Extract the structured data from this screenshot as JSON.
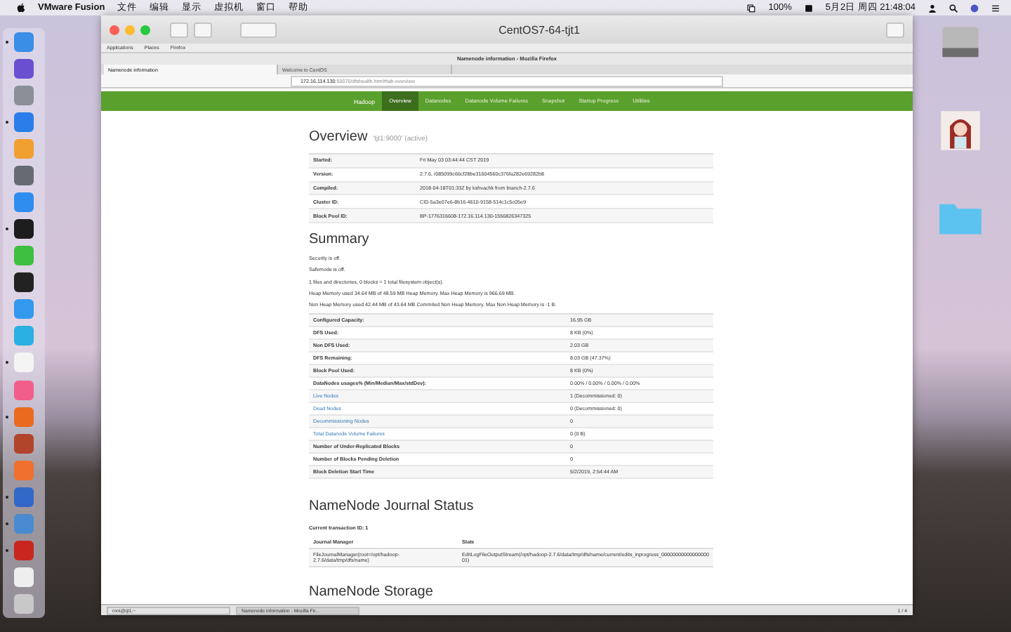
{
  "menubar": {
    "app": "VMware Fusion",
    "menus": [
      "文件",
      "编辑",
      "显示",
      "虚拟机",
      "窗口",
      "帮助"
    ],
    "battery": "100%",
    "clock": "5月2日 周四 21:48:04"
  },
  "dock": [
    {
      "running": true
    },
    {
      "running": false
    },
    {
      "running": false
    },
    {
      "running": true
    },
    {
      "running": false
    },
    {
      "running": false
    },
    {
      "running": false
    },
    {
      "running": true
    },
    {
      "running": false
    },
    {
      "running": false
    },
    {
      "running": false
    },
    {
      "running": false
    },
    {
      "running": true
    },
    {
      "running": false
    },
    {
      "running": true
    },
    {
      "running": false
    },
    {
      "running": false
    },
    {
      "running": true
    },
    {
      "running": true
    },
    {
      "running": true
    },
    {
      "running": false
    },
    {
      "running": false
    }
  ],
  "vm_window": {
    "title": "CentOS7-64-tjt1"
  },
  "gnome_top_bar": [
    "Applications",
    "Places",
    "Firefox"
  ],
  "firefox": {
    "title": "Namenode information - Mozilla Firefox",
    "tabs": [
      {
        "label": "Namenode information",
        "selected": true
      },
      {
        "label": "Welcome to CentOS",
        "selected": false
      }
    ],
    "url_host": "172.16.114.130",
    "url_path": ":50070/dfshealth.html#tab-overview"
  },
  "nav": {
    "brand": "Hadoop",
    "items": [
      {
        "label": "Overview",
        "selected": true
      },
      {
        "label": "Datanodes",
        "selected": false
      },
      {
        "label": "Datanode Volume Failures",
        "selected": false
      },
      {
        "label": "Snapshot",
        "selected": false
      },
      {
        "label": "Startup Progress",
        "selected": false
      },
      {
        "label": "Utilities",
        "selected": false
      }
    ]
  },
  "overview": {
    "title": "Overview",
    "subtitle": "'tjt1:9000' (active)",
    "rows": [
      {
        "key": "Started:",
        "value": "Fri May 03 03:44:44 CST 2019"
      },
      {
        "key": "Version:",
        "value": "2.7.6, r085099c66cf28be31604560c376fa282e69282b8"
      },
      {
        "key": "Compiled:",
        "value": "2018-04-18T01:33Z by kshvachk from branch-2.7.6"
      },
      {
        "key": "Cluster ID:",
        "value": "CID-5a3e07e6-8b16-4610-9158-514c1c5c05e9"
      },
      {
        "key": "Block Pool ID:",
        "value": "BP-1776316608-172.16.114.130-1556826347325"
      }
    ]
  },
  "summary": {
    "title": "Summary",
    "lines": [
      "Security is off.",
      "Safemode is off.",
      "1 files and directories, 0 blocks = 1 total filesystem object(s).",
      "Heap Memory used 34.64 MB of 48.59 MB Heap Memory. Max Heap Memory is 966.69 MB.",
      "Non Heap Memory used 42.44 MB of 43.64 MB Commited Non Heap Memory. Max Non Heap Memory is -1 B."
    ],
    "rows": [
      {
        "kind": "plain",
        "key": "Configured Capacity:",
        "value": "16.95 GB"
      },
      {
        "kind": "plain",
        "key": "DFS Used:",
        "value": "8 KB (0%)"
      },
      {
        "kind": "plain",
        "key": "Non DFS Used:",
        "value": "2.03 GB"
      },
      {
        "kind": "plain",
        "key": "DFS Remaining:",
        "value": "8.03 GB (47.37%)"
      },
      {
        "kind": "plain",
        "key": "Block Pool Used:",
        "value": "8 KB (0%)"
      },
      {
        "kind": "plain",
        "key": "DataNodes usages% (Min/Median/Max/stdDev):",
        "value": "0.00% / 0.00% / 0.00% / 0.00%"
      },
      {
        "kind": "link",
        "key": "Live Nodes",
        "value": "1 (Decommissioned: 0)"
      },
      {
        "kind": "link",
        "key": "Dead Nodes",
        "value": "0 (Decommissioned: 0)"
      },
      {
        "kind": "link",
        "key": "Decommissioning Nodes",
        "value": "0"
      },
      {
        "kind": "link",
        "key": "Total Datanode Volume Failures",
        "value": "0 (0 B)"
      },
      {
        "kind": "plain",
        "key": "Number of Under-Replicated Blocks",
        "value": "0"
      },
      {
        "kind": "plain",
        "key": "Number of Blocks Pending Deletion",
        "value": "0"
      },
      {
        "kind": "plain",
        "key": "Block Deletion Start Time",
        "value": "5/2/2019, 2:54:44 AM"
      }
    ]
  },
  "journal": {
    "title": "NameNode Journal Status",
    "transaction": "Current transaction ID: 1",
    "columns": [
      "Journal Manager",
      "State"
    ],
    "rows": [
      [
        "FileJournalManager(root=/opt/hadoop-2.7.6/data/tmp/dfs/name)",
        "EditLogFileOutputStream(/opt/hadoop-2.7.6/data/tmp/dfs/name/current/edits_inprogress_0000000000000000001)"
      ]
    ]
  },
  "storage": {
    "title": "NameNode Storage"
  },
  "taskbar": {
    "items": [
      {
        "label": "root@tjt1:~",
        "selected": false
      },
      {
        "label": "Namenode information - Mozilla Fir...",
        "selected": true
      }
    ],
    "pager": "1 / 4"
  }
}
